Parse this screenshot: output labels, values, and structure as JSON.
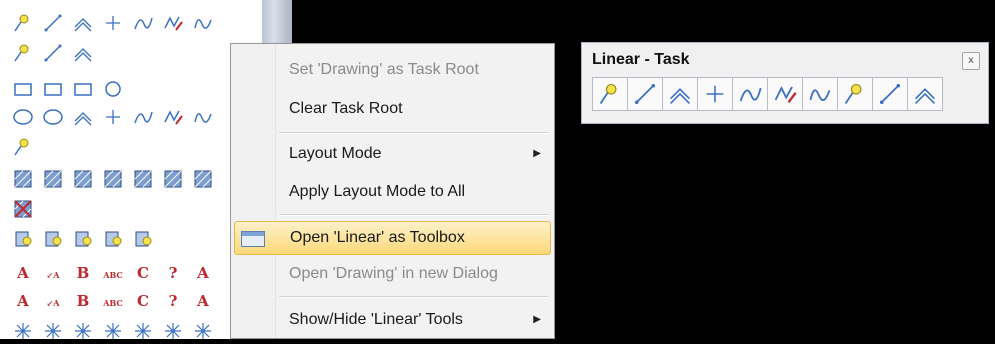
{
  "palette": {
    "rows": [
      [
        "place-smartline-icon",
        "place-line-icon",
        "place-multiline-icon",
        "place-point-icon",
        "place-bspline-icon",
        "place-stream-icon",
        "place-curve-icon"
      ],
      [
        "construct-bisector-icon",
        "construct-line-aa-icon",
        "construct-angle-icon"
      ],
      [
        "rectangle-icon",
        "polygon-icon",
        "shape-icon",
        "circle-icon"
      ],
      [
        "ellipse-icon",
        "ellipse-alt-icon",
        "arc-icon",
        "arc-3pt-icon",
        "arc-edit-icon",
        "arc-angle-icon",
        "arc-curve-icon"
      ],
      [
        "modify-arc-icon"
      ],
      [
        "fill-icon",
        "pattern-icon",
        "hatch-icon",
        "crosshatch-icon",
        "area-pattern-icon",
        "linear-pattern-icon",
        "edit-pattern-icon"
      ],
      [
        "delete-pattern-icon"
      ],
      [
        "cell-place-icon",
        "cell-select-icon",
        "cell-identify-icon",
        "cell-replace-icon",
        "cell-drop-icon"
      ],
      [
        "text-place-icon",
        "text-note-icon",
        "text-fraction-icon",
        "text-spell-icon",
        "text-case-icon",
        "text-edit-icon",
        "text-copy-icon"
      ],
      [
        "text-number-icon",
        "text-increment-icon",
        "text-a1a-icon",
        "text-a1-icon",
        "text-a2-icon",
        "text-abc-icon",
        "text-field-icon"
      ],
      [
        "star-icon",
        "dot-star-icon",
        "dot-icon",
        "tag-icon",
        "tag-alt-icon",
        "arrow-tag-icon",
        "snowflake-icon"
      ]
    ]
  },
  "context_menu": {
    "items": [
      {
        "label": "Set 'Drawing' as Task Root",
        "enabled": false
      },
      {
        "label": "Clear Task Root",
        "enabled": true
      },
      {
        "label": "Layout Mode",
        "enabled": true,
        "submenu": true
      },
      {
        "label": "Apply Layout Mode to All",
        "enabled": true
      },
      {
        "label": "Open 'Linear' as Toolbox",
        "enabled": true,
        "highlighted": true
      },
      {
        "label": "Open 'Drawing' in new Dialog",
        "enabled": false
      },
      {
        "label": "Show/Hide 'Linear' Tools",
        "enabled": true,
        "submenu": true
      }
    ]
  },
  "toolbox": {
    "title": "Linear - Task",
    "close_glyph": "x",
    "tools": [
      "place-smartline-icon",
      "place-line-icon",
      "place-multiline-icon",
      "place-point-icon",
      "place-bspline-icon",
      "place-stream-icon",
      "place-curve-icon",
      "construct-bisector-icon",
      "construct-line-aa-icon",
      "construct-angle-icon"
    ]
  },
  "colors": {
    "menu_bg": "#f2f2f2",
    "highlight_top": "#fdf1c9",
    "highlight_bottom": "#fbd879",
    "icon_blue": "#3a6fc4",
    "icon_red": "#c0282d"
  }
}
